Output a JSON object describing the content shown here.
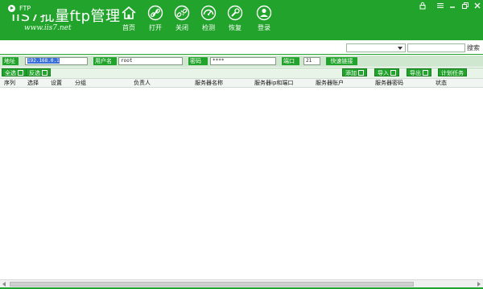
{
  "app": {
    "logo_text": "IIS7批量ftp管理",
    "logo_url": "www.iis7.net"
  },
  "toolbar": {
    "items": [
      {
        "label": "首页",
        "icon": "home-icon"
      },
      {
        "label": "打开",
        "icon": "link-icon"
      },
      {
        "label": "关闭",
        "icon": "unlink-icon"
      },
      {
        "label": "检测",
        "icon": "gauge-icon"
      },
      {
        "label": "恢复",
        "icon": "wrench-icon"
      },
      {
        "label": "登录",
        "icon": "user-icon"
      }
    ]
  },
  "tab": {
    "label": "FTP"
  },
  "search": {
    "button_label": "搜索",
    "select_value": "",
    "input_value": ""
  },
  "form": {
    "address_label": "地址",
    "address_value": "192.168.0.1",
    "username_label": "用户名",
    "username_value": "root",
    "password_label": "密码",
    "password_value": "****",
    "port_label": "端口",
    "port_value": "21",
    "quick_link_label": "快速链接"
  },
  "actions": {
    "select_all": "全选",
    "invert": "反选",
    "add": "添加",
    "import": "导入",
    "export": "导出",
    "schedule": "计划任务"
  },
  "table": {
    "columns": [
      "序列",
      "选择",
      "设置",
      "分组",
      "负责人",
      "服务器名称",
      "服务器ip和端口",
      "服务器账户",
      "服务器密码",
      "状态"
    ],
    "rows": []
  },
  "colors": {
    "brand_green": "#22a32b",
    "form_bg": "#cfe6cf"
  }
}
